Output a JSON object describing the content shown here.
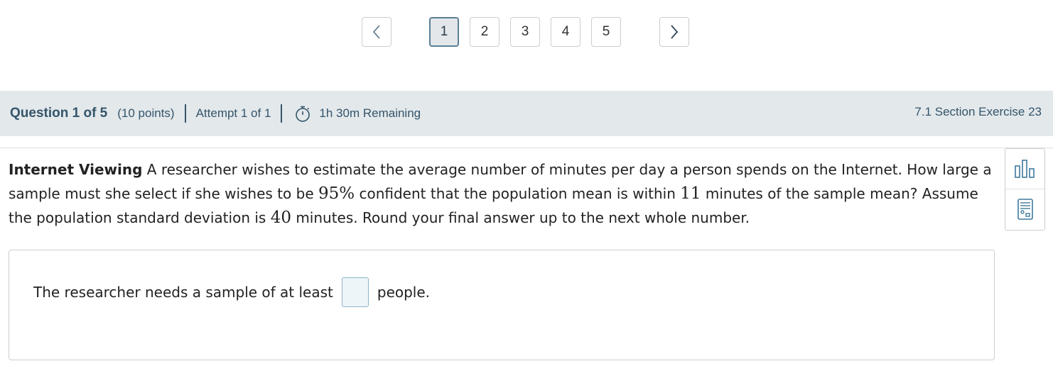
{
  "pagination": {
    "prev_icon": "chevron-left-icon",
    "next_icon": "chevron-right-icon",
    "pages": [
      "1",
      "2",
      "3",
      "4",
      "5"
    ],
    "active_page": "1"
  },
  "header": {
    "question_label": "Question 1 of 5",
    "points": "(10 points)",
    "attempt": "Attempt 1 of 1",
    "timer_icon": "stopwatch-icon",
    "remaining": "1h 30m Remaining",
    "section": "7.1 Section Exercise 23"
  },
  "question": {
    "title": "Internet Viewing",
    "text_1": " A researcher wishes to estimate the average number of minutes per day a person spends on the Internet. How large a sample must she select if she wishes to be ",
    "confidence": "95%",
    "text_2": " confident that the population mean is within ",
    "margin": "11",
    "text_3": " minutes of the sample mean? Assume the population standard deviation is ",
    "sd": "40",
    "text_4": " minutes. Round your final answer up to the next whole number."
  },
  "tools": {
    "stats_icon": "bar-chart-icon",
    "calc_icon": "calculator-icon"
  },
  "answer": {
    "prefix": "The researcher needs a sample of at least",
    "value": "",
    "suffix": "people."
  }
}
